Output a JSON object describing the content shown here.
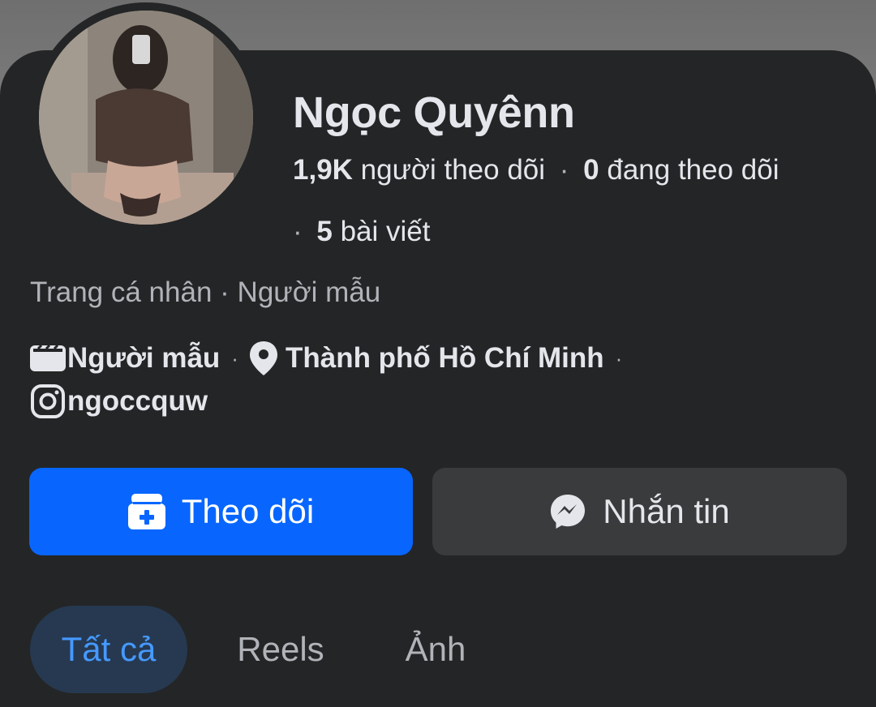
{
  "profile": {
    "name": "Ngọc Quyênn",
    "followers_count": "1,9K",
    "followers_label": "người theo dõi",
    "following_count": "0",
    "following_label": "đang theo dõi",
    "posts_count": "5",
    "posts_label": "bài viết",
    "page_type": "Trang cá nhân",
    "category": "Người mẫu"
  },
  "details": {
    "occupation": "Người mẫu",
    "location": "Thành phố Hồ Chí Minh",
    "instagram": "ngoccquw"
  },
  "actions": {
    "follow_label": "Theo dõi",
    "message_label": "Nhắn tin"
  },
  "tabs": [
    {
      "label": "Tất cả",
      "active": true
    },
    {
      "label": "Reels",
      "active": false
    },
    {
      "label": "Ảnh",
      "active": false
    }
  ],
  "icons": {
    "occupation": "briefcase-icon",
    "location": "location-pin-icon",
    "instagram": "instagram-icon",
    "follow": "follow-box-icon",
    "message": "messenger-icon"
  },
  "colors": {
    "background": "#242526",
    "primary_button": "#0866ff",
    "secondary_button": "#3a3b3c",
    "active_tab_bg": "#263951",
    "active_tab_text": "#4599ff",
    "text_primary": "#e4e6eb",
    "text_secondary": "#b0b3b8"
  }
}
